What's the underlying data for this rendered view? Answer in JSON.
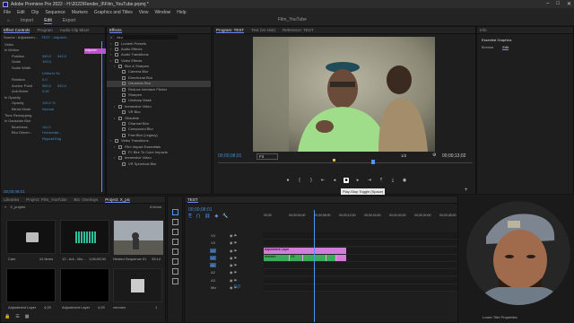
{
  "window": {
    "app_title": "Adobe Premiere Pro 2022 - H:\\2022\\Render_II\\Film_YouTube.prproj *",
    "file_title": "Film_YouTube"
  },
  "menu": [
    "File",
    "Edit",
    "Clip",
    "Sequence",
    "Markers",
    "Graphics and Titles",
    "View",
    "Window",
    "Help"
  ],
  "workspace_tabs": [
    "Import",
    "Edit",
    "Export"
  ],
  "source_panel": {
    "tabs": [
      "Source : Adjustmen...",
      "TEST - Adjustm...",
      "Audio Clip Mixer: TEST"
    ],
    "clip_badge": "Adjustm",
    "rows": [
      {
        "label": "Video",
        "v1": "",
        "v2": ""
      },
      {
        "label": "fx Motion",
        "v1": "",
        "v2": ""
      },
      {
        "label": "Position",
        "v1": "960,0",
        "v2": "540,0"
      },
      {
        "label": "Scale",
        "v1": "100,0",
        "v2": ""
      },
      {
        "label": "Scale Width",
        "v1": "",
        "v2": ""
      },
      {
        "label": "",
        "v1": "Uniform Sc",
        "v2": ""
      },
      {
        "label": "Rotation",
        "v1": "0,0",
        "v2": ""
      },
      {
        "label": "Anchor Point",
        "v1": "960,0",
        "v2": "540,0"
      },
      {
        "label": "Anti-flicker",
        "v1": "0,00",
        "v2": ""
      },
      {
        "label": "fx Opacity",
        "v1": "",
        "v2": ""
      },
      {
        "label": "Opacity",
        "v1": "100,0 %",
        "v2": ""
      },
      {
        "label": "Blend Mode",
        "v1": "Normal",
        "v2": ""
      },
      {
        "label": "Time Remapping",
        "v1": "",
        "v2": ""
      },
      {
        "label": "fx Gaussian Blur",
        "v1": "",
        "v2": ""
      },
      {
        "label": "Blurriness",
        "v1": "111,0",
        "v2": ""
      },
      {
        "label": "Blur Dimen...",
        "v1": "Horizontal...",
        "v2": ""
      },
      {
        "label": "",
        "v1": "Repeat Edg",
        "v2": ""
      }
    ],
    "timecode": "00;00;08;01"
  },
  "effects_panel": {
    "tab": "Effects",
    "search": "blur",
    "items": [
      {
        "label": "Lumetri Presets",
        "indent": 1,
        "sel": false
      },
      {
        "label": "Audio Effects",
        "indent": 1,
        "sel": false
      },
      {
        "label": "Audio Transitions",
        "indent": 1,
        "sel": false
      },
      {
        "label": "Video Effects",
        "indent": 1,
        "sel": false
      },
      {
        "label": "Blur & Sharpen",
        "indent": 2,
        "sel": false
      },
      {
        "label": "Camera Blur",
        "indent": 3,
        "sel": false
      },
      {
        "label": "Directional Blur",
        "indent": 3,
        "sel": false
      },
      {
        "label": "Gaussian Blur",
        "indent": 3,
        "sel": true
      },
      {
        "label": "Reduce Interlace Flicker",
        "indent": 3,
        "sel": false
      },
      {
        "label": "Sharpen",
        "indent": 3,
        "sel": false
      },
      {
        "label": "Unsharp Mask",
        "indent": 3,
        "sel": false
      },
      {
        "label": "Immersive Video",
        "indent": 2,
        "sel": false
      },
      {
        "label": "VR Blur",
        "indent": 3,
        "sel": false
      },
      {
        "label": "Obsolete",
        "indent": 2,
        "sel": false
      },
      {
        "label": "Channel Blur",
        "indent": 3,
        "sel": false
      },
      {
        "label": "Compound Blur",
        "indent": 3,
        "sel": false
      },
      {
        "label": "Fast Blur (Legacy)",
        "indent": 3,
        "sel": false
      },
      {
        "label": "Video Transitions",
        "indent": 1,
        "sel": false
      },
      {
        "label": "Film Impact Essentials",
        "indent": 2,
        "sel": false
      },
      {
        "label": "FI: Blur To Color Impacts",
        "indent": 3,
        "sel": false
      },
      {
        "label": "Immersive Video",
        "indent": 2,
        "sel": false
      },
      {
        "label": "VR Spherical Blur",
        "indent": 3,
        "sel": false
      }
    ]
  },
  "program_monitor": {
    "tabs": [
      "Program: TEST",
      "Text (Vo Hist)",
      "Reference: TEST"
    ],
    "timecode_left": "00;00;08;01",
    "fit": "Fit",
    "quality": "1/2",
    "timecode_right": "00;00;13;02",
    "tooltip": "Play-Stop Toggle (Space)"
  },
  "essential_graphics": {
    "tab_title": "Info",
    "panel": "Essential Graphics",
    "subtabs": [
      "Browse",
      "Edit"
    ]
  },
  "project_panel": {
    "tabs": [
      "Libraries",
      "Project: Film_YouTube",
      "Bin: Overlays",
      "Project: X_pic"
    ],
    "search": "X_projeto",
    "count": "8 items",
    "items": [
      {
        "name": "Cam",
        "meta": "41 items"
      },
      {
        "name": "12 - Ani - Ma...",
        "meta": "1;06;00;00"
      },
      {
        "name": "Nested Sequence 01",
        "meta": "33;14"
      },
      {
        "name": "Adjustment Layer",
        "meta": "4;29"
      },
      {
        "name": "Adjustment Layer",
        "meta": "4;29"
      },
      {
        "name": "veronex",
        "meta": "1"
      }
    ]
  },
  "timeline": {
    "tab": "TEST",
    "timecode": "00;00;08;01",
    "ruler": [
      "00;00",
      "00;00;04;00",
      "00;00;08;00",
      "00;00;12;00",
      "00;00;16;00",
      "00;00;20;00",
      "00;00;24;00",
      "00;00;28;00"
    ],
    "tracks": [
      "V4",
      "V3",
      "V2",
      "V1",
      "A1",
      "A2",
      "A3",
      "Mix"
    ],
    "mix_value": "0,0",
    "adjust_clip": "Adjustment Layer",
    "v1_clip": "veronex",
    "v1_clip_b": "C6"
  },
  "webcam": {
    "label": "Lower Title Properties"
  },
  "colors": {
    "accent": "#6e8cff",
    "clip_pink": "#d27ed7",
    "clip_green": "#3eaa58",
    "playhead": "#4d95ff"
  }
}
